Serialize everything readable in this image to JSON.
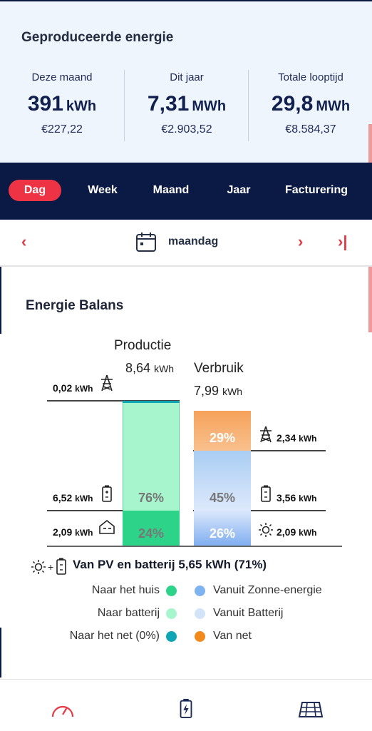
{
  "header": {
    "title": "Geproduceerde energie",
    "stats": [
      {
        "label": "Deze maand",
        "value": "391",
        "unit": "kWh",
        "money": "€227,22"
      },
      {
        "label": "Dit jaar",
        "value": "7,31",
        "unit": "MWh",
        "money": "€2.903,52"
      },
      {
        "label": "Totale looptijd",
        "value": "29,8",
        "unit": "MWh",
        "money": "€8.584,37"
      }
    ]
  },
  "tabs": [
    "Dag",
    "Week",
    "Maand",
    "Jaar",
    "Facturering"
  ],
  "active_tab": "Dag",
  "date": {
    "prev": "‹",
    "label": "maandag",
    "next": "›",
    "last": "›|"
  },
  "section_title": "Energie Balans",
  "balance": {
    "production": {
      "title": "Productie",
      "total": "8,64",
      "unit": "kWh",
      "grid": "0,02",
      "battery": "6,52",
      "home": "2,09",
      "battery_pct": "76%",
      "home_pct": "24%"
    },
    "consumption": {
      "title": "Verbruik",
      "total": "7,99",
      "unit": "kWh",
      "grid": "2,34",
      "battery": "3,56",
      "solar": "2,09",
      "grid_pct": "29%",
      "battery_pct": "45%",
      "solar_pct": "26%"
    },
    "kwh": "kWh"
  },
  "pv_summary": "Van PV en batterij 5,65 kWh (71%)",
  "legend": {
    "left": [
      "Naar het huis",
      "Naar batterij",
      "Naar het net (0%)"
    ],
    "right": [
      "Vanuit Zonne-energie",
      "Vanuit Batterij",
      "Van net"
    ],
    "colors": {
      "home": "#2ed38a",
      "battery": "#a6f5cc",
      "grid": "#0ea5b5",
      "solar": "#7fb2f0",
      "from_battery": "#d3e3f8",
      "from_grid": "#f08a1c"
    }
  },
  "bottom_nav": [
    "gauge-icon",
    "battery-icon",
    "solar-panel-icon"
  ]
}
